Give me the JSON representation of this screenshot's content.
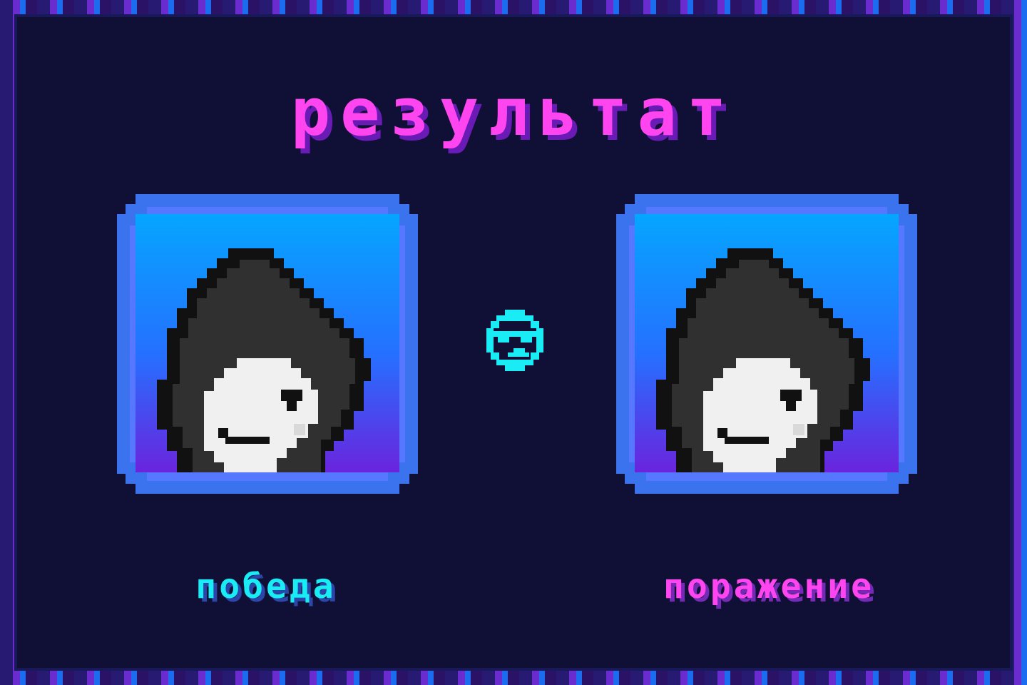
{
  "screen": {
    "title": "результат"
  },
  "players": [
    {
      "result_label": "победа",
      "avatar_icon": "hooded-skull-avatar-icon",
      "accent_color": "#19ecf4"
    },
    {
      "result_label": "поражение",
      "avatar_icon": "hooded-skull-avatar-icon",
      "accent_color": "#ff45ef"
    }
  ],
  "center_icon": {
    "name": "cool-face-icon",
    "color": "#19ecf4"
  },
  "colors": {
    "background": "#0f1034",
    "title": "#ff45ef",
    "card_top": "#05a6ff",
    "card_bottom": "#6a24dd",
    "card_border": "#3e72ee"
  }
}
